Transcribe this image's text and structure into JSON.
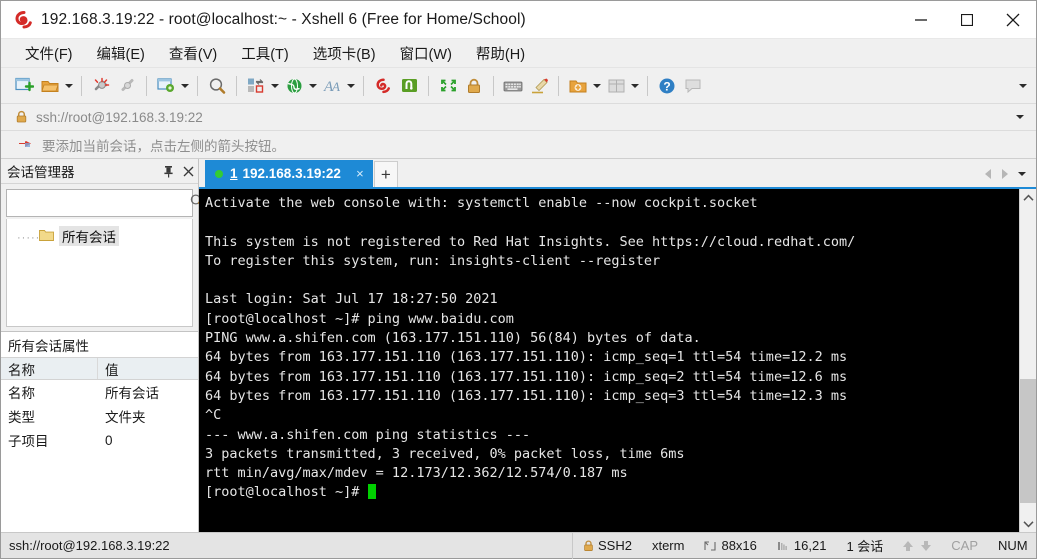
{
  "window": {
    "title": "192.168.3.19:22 - root@localhost:~ - Xshell 6 (Free for Home/School)",
    "app_icon": "xshell-logo-icon",
    "minimize_label": "—",
    "maximize_label": "□",
    "close_label": "✕"
  },
  "menubar": {
    "items": [
      {
        "label": "文件(F)",
        "name": "menu-file"
      },
      {
        "label": "编辑(E)",
        "name": "menu-edit"
      },
      {
        "label": "查看(V)",
        "name": "menu-view"
      },
      {
        "label": "工具(T)",
        "name": "menu-tools"
      },
      {
        "label": "选项卡(B)",
        "name": "menu-tabs"
      },
      {
        "label": "窗口(W)",
        "name": "menu-window"
      },
      {
        "label": "帮助(H)",
        "name": "menu-help"
      }
    ]
  },
  "toolbar": {
    "icons": [
      "new-session-icon",
      "open-folder-icon",
      "disconnect-icon",
      "reconnect-icon",
      "session-properties-icon",
      "find-icon",
      "transfer-file-icon",
      "web-browser-icon",
      "font-icon",
      "xshell-icon",
      "xftp-icon",
      "fullscreen-icon",
      "lock-icon",
      "keyboard-icon",
      "highlight-icon",
      "add-folder-icon",
      "layout-icon",
      "help-icon",
      "chat-icon"
    ],
    "overflow_label": "▾"
  },
  "address": {
    "lock_icon": "lock-icon",
    "value": "ssh://root@192.168.3.19:22",
    "dropdown_label": "▾"
  },
  "notice": {
    "icon": "red-arrow-icon",
    "text": "要添加当前会话，点击左侧的箭头按钮。"
  },
  "sidebar": {
    "title": "会话管理器",
    "pin_label": "⚲",
    "close_label": "✕",
    "search": {
      "value": "",
      "placeholder": ""
    },
    "tree": [
      {
        "label": "所有会话",
        "icon": "folder-icon"
      }
    ],
    "properties": {
      "title": "所有会话属性",
      "headers": [
        "名称",
        "值"
      ],
      "rows": [
        {
          "name": "名称",
          "value": "所有会话"
        },
        {
          "name": "类型",
          "value": "文件夹"
        },
        {
          "name": "子项目",
          "value": "0"
        }
      ]
    }
  },
  "tabs": {
    "items": [
      {
        "index": "1",
        "title": "192.168.3.19:22",
        "status": "connected",
        "close_label": "×"
      }
    ],
    "new_tab_label": "+",
    "nav_prev": "◀",
    "nav_next": "▶",
    "nav_menu": "▾"
  },
  "terminal": {
    "lines": [
      "Activate the web console with: systemctl enable --now cockpit.socket",
      "",
      "This system is not registered to Red Hat Insights. See https://cloud.redhat.com/",
      "To register this system, run: insights-client --register",
      "",
      "Last login: Sat Jul 17 18:27:50 2021",
      "[root@localhost ~]# ping www.baidu.com",
      "PING www.a.shifen.com (163.177.151.110) 56(84) bytes of data.",
      "64 bytes from 163.177.151.110 (163.177.151.110): icmp_seq=1 ttl=54 time=12.2 ms",
      "64 bytes from 163.177.151.110 (163.177.151.110): icmp_seq=2 ttl=54 time=12.6 ms",
      "64 bytes from 163.177.151.110 (163.177.151.110): icmp_seq=3 ttl=54 time=12.3 ms",
      "^C",
      "--- www.a.shifen.com ping statistics ---",
      "3 packets transmitted, 3 received, 0% packet loss, time 6ms",
      "rtt min/avg/max/mdev = 12.173/12.362/12.574/0.187 ms"
    ],
    "prompt": "[root@localhost ~]# ",
    "scrollbar": {
      "up_label": "ⱏ",
      "down_label": "ⱟ"
    }
  },
  "statusbar": {
    "connection": "ssh://root@192.168.3.19:22",
    "protocol": "SSH2",
    "protocol_icon": "lock-icon",
    "terminal_type": "xterm",
    "size_icon": "resize-icon",
    "size": "88x16",
    "cursor_icon": "cursor-pos-icon",
    "cursor_pos": "16,21",
    "sessions": "1 会话",
    "caps": "CAP",
    "num": "NUM"
  },
  "colors": {
    "accent": "#1e8ad6",
    "terminal_bg": "#000000",
    "terminal_fg": "#e6e6e6",
    "cursor": "#00d000",
    "chrome": "#f0f0f0",
    "status_bg": "#e4e4e4"
  }
}
